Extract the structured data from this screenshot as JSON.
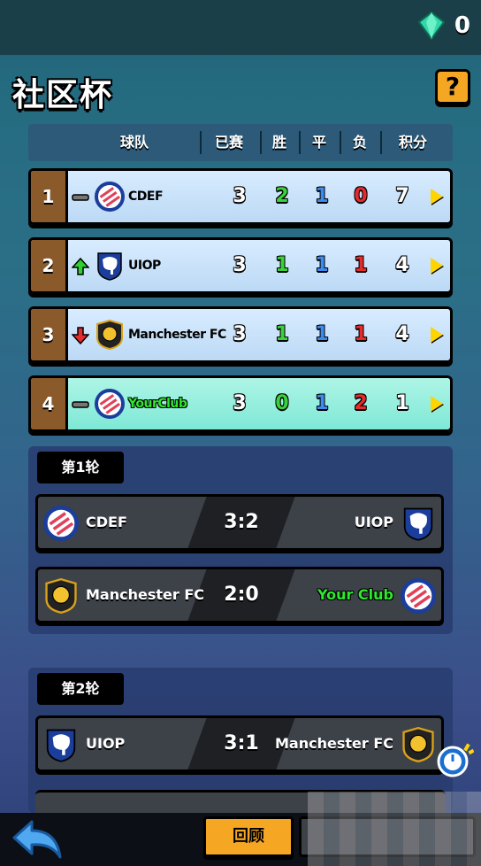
{
  "header": {
    "gem_count": "0",
    "title": "社区杯",
    "help_label": "?"
  },
  "columns": {
    "team": "球队",
    "played": "已赛",
    "won": "胜",
    "draw": "平",
    "lost": "负",
    "points": "积分"
  },
  "standings": [
    {
      "rank": "1",
      "trend": "same",
      "crest": "stripe-crest-icon",
      "team": "CDEF",
      "played": "3",
      "won": "2",
      "draw": "1",
      "lost": "0",
      "points": "7",
      "mine": false
    },
    {
      "rank": "2",
      "trend": "up",
      "crest": "elephant-crest-icon",
      "team": "UIOP",
      "played": "3",
      "won": "1",
      "draw": "1",
      "lost": "1",
      "points": "4",
      "mine": false
    },
    {
      "rank": "3",
      "trend": "down",
      "crest": "lion-crest-icon",
      "team": "Manchester FC",
      "played": "3",
      "won": "1",
      "draw": "1",
      "lost": "1",
      "points": "4",
      "mine": false
    },
    {
      "rank": "4",
      "trend": "same",
      "crest": "stripe-crest-icon",
      "team": "YourClub",
      "played": "3",
      "won": "0",
      "draw": "1",
      "lost": "2",
      "points": "1",
      "mine": true
    }
  ],
  "rounds": [
    {
      "label": "第1轮",
      "matches": [
        {
          "home": "CDEF",
          "home_crest": "stripe-crest-icon",
          "score": "3:2",
          "away": "UIOP",
          "away_crest": "elephant-crest-icon",
          "home_mine": false,
          "away_mine": false
        },
        {
          "home": "Manchester FC",
          "home_crest": "lion-crest-icon",
          "score": "2:0",
          "away": "Your Club",
          "away_crest": "stripe-crest-icon",
          "home_mine": false,
          "away_mine": true
        }
      ]
    },
    {
      "label": "第2轮",
      "matches": [
        {
          "home": "UIOP",
          "home_crest": "elephant-crest-icon",
          "score": "3:1",
          "away": "Manchester FC",
          "away_crest": "lion-crest-icon",
          "home_mine": false,
          "away_mine": false
        }
      ]
    }
  ],
  "footer": {
    "review_label": "回顾"
  },
  "colors": {
    "win": "#3ad13a",
    "draw": "#3c8cf0",
    "loss": "#e52b2b",
    "points": "#ffffff",
    "played": "#ffffff"
  }
}
